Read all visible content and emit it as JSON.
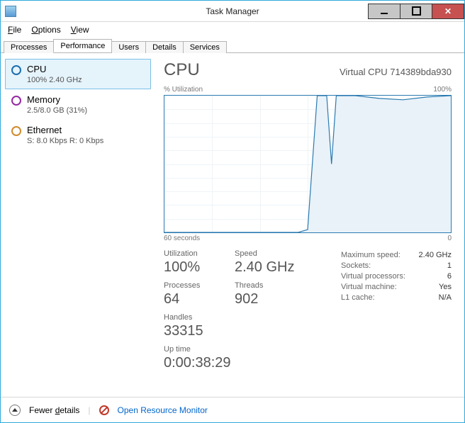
{
  "title": "Task Manager",
  "menu": {
    "file": "File",
    "options": "Options",
    "view": "View"
  },
  "tabs": {
    "processes": "Processes",
    "performance": "Performance",
    "users": "Users",
    "details": "Details",
    "services": "Services"
  },
  "sidebar": {
    "cpu": {
      "label": "CPU",
      "sub": "100%  2.40 GHz"
    },
    "memory": {
      "label": "Memory",
      "sub": "2.5/8.0 GB (31%)"
    },
    "ethernet": {
      "label": "Ethernet",
      "sub": "S: 8.0 Kbps  R: 0 Kbps"
    }
  },
  "detail": {
    "heading": "CPU",
    "cpu_name": "Virtual CPU 714389bda930",
    "chart_top_left": "% Utilization",
    "chart_top_right": "100%",
    "chart_bottom_left": "60 seconds",
    "chart_bottom_right": "0",
    "stats": {
      "utilization_label": "Utilization",
      "utilization": "100%",
      "speed_label": "Speed",
      "speed": "2.40 GHz",
      "processes_label": "Processes",
      "processes": "64",
      "threads_label": "Threads",
      "threads": "902",
      "handles_label": "Handles",
      "handles": "33315",
      "uptime_label": "Up time",
      "uptime": "0:00:38:29"
    },
    "meta": {
      "max_speed_label": "Maximum speed:",
      "max_speed": "2.40 GHz",
      "sockets_label": "Sockets:",
      "sockets": "1",
      "vproc_label": "Virtual processors:",
      "vproc": "6",
      "vm_label": "Virtual machine:",
      "vm": "Yes",
      "l1_label": "L1 cache:",
      "l1": "N/A"
    }
  },
  "bottom": {
    "fewer": "Fewer details",
    "resmon": "Open Resource Monitor"
  },
  "chart_data": {
    "type": "line",
    "title": "% Utilization",
    "xlabel": "60 seconds → 0",
    "ylabel": "% Utilization",
    "ylim": [
      0,
      100
    ],
    "x_seconds_ago": [
      60,
      55,
      50,
      45,
      40,
      35,
      32,
      30,
      28,
      27,
      26,
      25,
      24,
      23,
      22,
      20,
      15,
      10,
      5,
      0
    ],
    "values": [
      0,
      0,
      0,
      0,
      0,
      0,
      0,
      2,
      100,
      100,
      100,
      50,
      100,
      100,
      100,
      100,
      98,
      97,
      99,
      100
    ]
  }
}
